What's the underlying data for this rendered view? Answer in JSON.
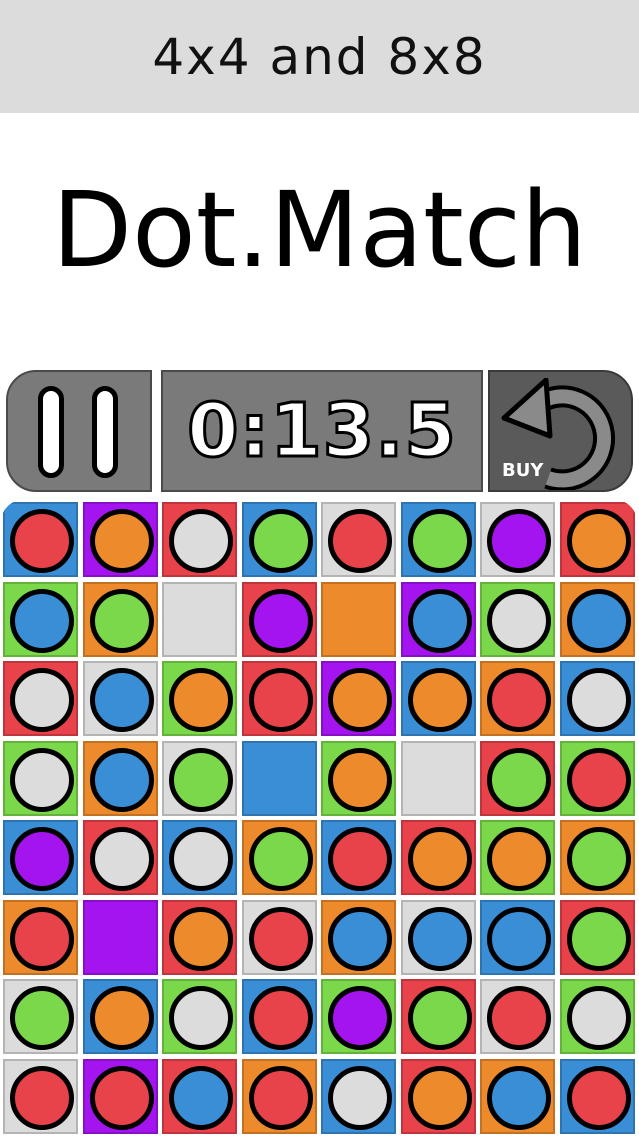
{
  "banner": {
    "subtitle": "4x4 and 8x8"
  },
  "app": {
    "title": "Dot.Match"
  },
  "controls": {
    "timer": "0:13.5",
    "buy_label": "BUY",
    "pause_icon": "pause-icon",
    "undo_icon": "undo-icon"
  },
  "colors": {
    "R": "#e8424b",
    "O": "#ec8a2c",
    "W": "#dcdcdc",
    "G": "#7ad84a",
    "B": "#3a8ed6",
    "P": "#a414ee"
  },
  "board": {
    "rows": 8,
    "cols": 8,
    "tiles": [
      [
        "B",
        "P",
        "R",
        "B",
        "W",
        "B",
        "W",
        "R"
      ],
      [
        "G",
        "O",
        "W",
        "R",
        "O",
        "P",
        "G",
        "O"
      ],
      [
        "R",
        "W",
        "G",
        "R",
        "P",
        "B",
        "O",
        "B"
      ],
      [
        "G",
        "O",
        "W",
        "B",
        "G",
        "W",
        "R",
        "G"
      ],
      [
        "B",
        "R",
        "B",
        "O",
        "B",
        "R",
        "G",
        "O"
      ],
      [
        "O",
        "P",
        "R",
        "W",
        "O",
        "W",
        "B",
        "R"
      ],
      [
        "W",
        "B",
        "G",
        "B",
        "G",
        "R",
        "W",
        "G"
      ],
      [
        "W",
        "P",
        "R",
        "O",
        "B",
        "R",
        "O",
        "B"
      ]
    ],
    "dots": [
      [
        "R",
        "O",
        "W",
        "G",
        "R",
        "G",
        "P",
        "O"
      ],
      [
        "B",
        "G",
        null,
        "P",
        null,
        "B",
        "W",
        "B"
      ],
      [
        "W",
        "B",
        "O",
        "R",
        "O",
        "O",
        "R",
        "W"
      ],
      [
        "W",
        "B",
        "G",
        null,
        "O",
        null,
        "G",
        "R"
      ],
      [
        "P",
        "W",
        "W",
        "G",
        "R",
        "O",
        "O",
        "G"
      ],
      [
        "R",
        null,
        "O",
        "R",
        "B",
        "B",
        "B",
        "G"
      ],
      [
        "G",
        "O",
        "W",
        "R",
        "P",
        "G",
        "R",
        "W"
      ],
      [
        "R",
        "R",
        "B",
        "R",
        "W",
        "O",
        "B",
        "R"
      ]
    ]
  }
}
